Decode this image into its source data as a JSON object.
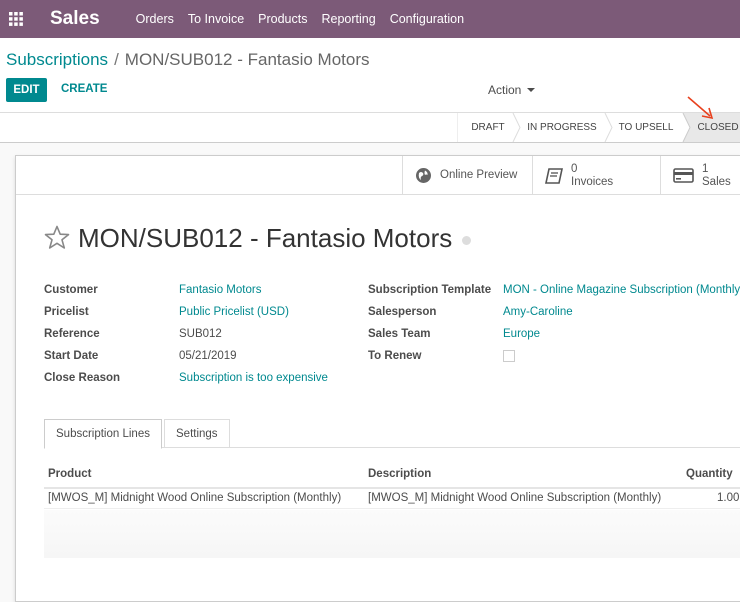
{
  "navbar": {
    "app_title": "Sales",
    "menu": [
      "Orders",
      "To Invoice",
      "Products",
      "Reporting",
      "Configuration"
    ],
    "color": "#7c5a78"
  },
  "breadcrumb": {
    "parent": "Subscriptions",
    "separator": "/",
    "current": "MON/SUB012 - Fantasio Motors"
  },
  "buttons": {
    "edit": "EDIT",
    "create": "CREATE",
    "action": "Action"
  },
  "stages": [
    "DRAFT",
    "IN PROGRESS",
    "TO UPSELL",
    "CLOSED"
  ],
  "active_stage": "CLOSED",
  "smart_buttons": {
    "preview": "Online Preview",
    "invoices_count": "0",
    "invoices_label": "Invoices",
    "sales_count": "1",
    "sales_label": "Sales"
  },
  "record": {
    "title": "MON/SUB012 - Fantasio Motors"
  },
  "fields_left": [
    {
      "label": "Customer",
      "value": "Fantasio Motors",
      "link": true
    },
    {
      "label": "Pricelist",
      "value": "Public Pricelist (USD)",
      "link": true
    },
    {
      "label": "Reference",
      "value": "SUB012",
      "link": false
    },
    {
      "label": "Start Date",
      "value": "05/21/2019",
      "link": false
    },
    {
      "label": "Close Reason",
      "value": "Subscription is too expensive",
      "link": true
    }
  ],
  "fields_right": [
    {
      "label": "Subscription Template",
      "value": "MON - Online Magazine Subscription (Monthly)"
    },
    {
      "label": "Salesperson",
      "value": "Amy-Caroline"
    },
    {
      "label": "Sales Team",
      "value": "Europe"
    },
    {
      "label": "To Renew",
      "value": ""
    }
  ],
  "tabs": [
    "Subscription Lines",
    "Settings"
  ],
  "table": {
    "headers": [
      "Product",
      "Description",
      "Quantity"
    ],
    "rows": [
      {
        "product": "[MWOS_M] Midnight Wood Online Subscription (Monthly)",
        "description": "[MWOS_M] Midnight Wood Online Subscription (Monthly)",
        "quantity": "1.00"
      }
    ]
  },
  "colors": {
    "accent": "#00898f",
    "annotation_arrow": "#e8411e"
  }
}
